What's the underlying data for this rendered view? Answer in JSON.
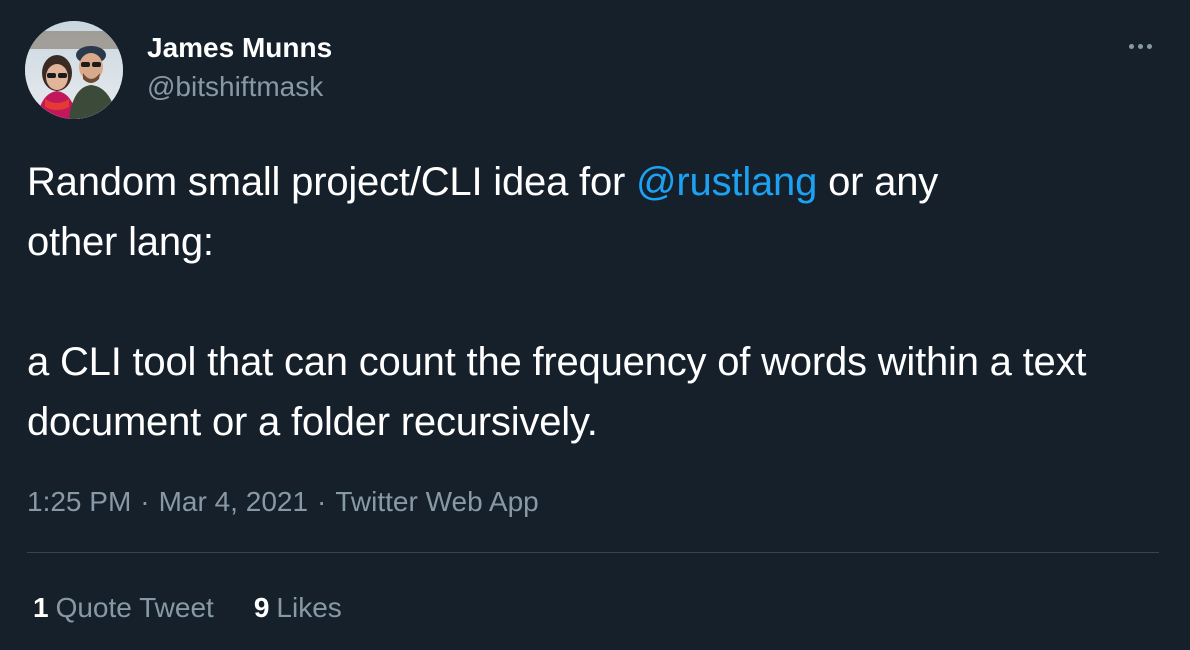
{
  "author": {
    "display_name": "James Munns",
    "handle": "@bitshiftmask"
  },
  "more_icon": "more-horizontal-icon",
  "tweet": {
    "line1_before": "Random small project/CLI idea for ",
    "mention": "@rustlang",
    "line1_after": " or any",
    "line2": "other lang:",
    "paragraph2": "a CLI tool that can count the frequency of words within a text document or a folder recursively."
  },
  "meta": {
    "time": "1:25 PM",
    "separator": "·",
    "date": "Mar 4, 2021",
    "source": "Twitter Web App"
  },
  "stats": {
    "quote_count": "1",
    "quote_label": "Quote Tweet",
    "likes_count": "9",
    "likes_label": "Likes"
  },
  "colors": {
    "background": "#15202b",
    "text": "#ffffff",
    "secondary": "#8899a6",
    "link": "#1da1f2",
    "divider": "#38444d"
  }
}
